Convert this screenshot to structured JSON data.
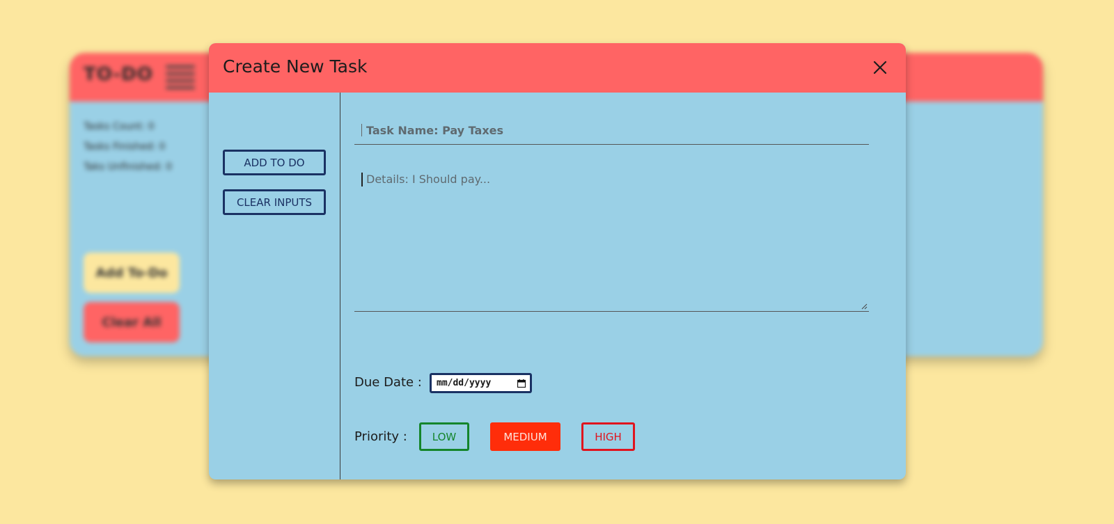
{
  "background_app": {
    "title": "TO-DO",
    "stats": [
      "Tasks Count: 0",
      "Tasks Finished: 0",
      "Taks Unfinished: 0"
    ],
    "add_button": "Add To-Do",
    "clear_button": "Clear All"
  },
  "modal": {
    "title": "Create New Task",
    "close_icon": "close-icon",
    "sidebar": {
      "add_button": "ADD TO DO",
      "clear_button": "CLEAR INPUTS"
    },
    "task_name": {
      "value": "",
      "placeholder": "Task Name: Pay Taxes"
    },
    "details": {
      "value": "",
      "placeholder": "Details: I Should pay..."
    },
    "due_date": {
      "label": "Due Date :",
      "placeholder": "mm/dd/yyyy",
      "icon": "calendar-icon"
    },
    "priority": {
      "label": "Priority :",
      "options": [
        "LOW",
        "MEDIUM",
        "HIGH"
      ],
      "selected": "MEDIUM"
    }
  },
  "colors": {
    "page_background": "#fce79f",
    "panel_background": "#9ad0e6",
    "header_background": "#ff6464",
    "button_border": "#1a3163",
    "priority_low": "#14852b",
    "priority_medium": "#ff2d0a",
    "priority_high": "#e0141e"
  }
}
